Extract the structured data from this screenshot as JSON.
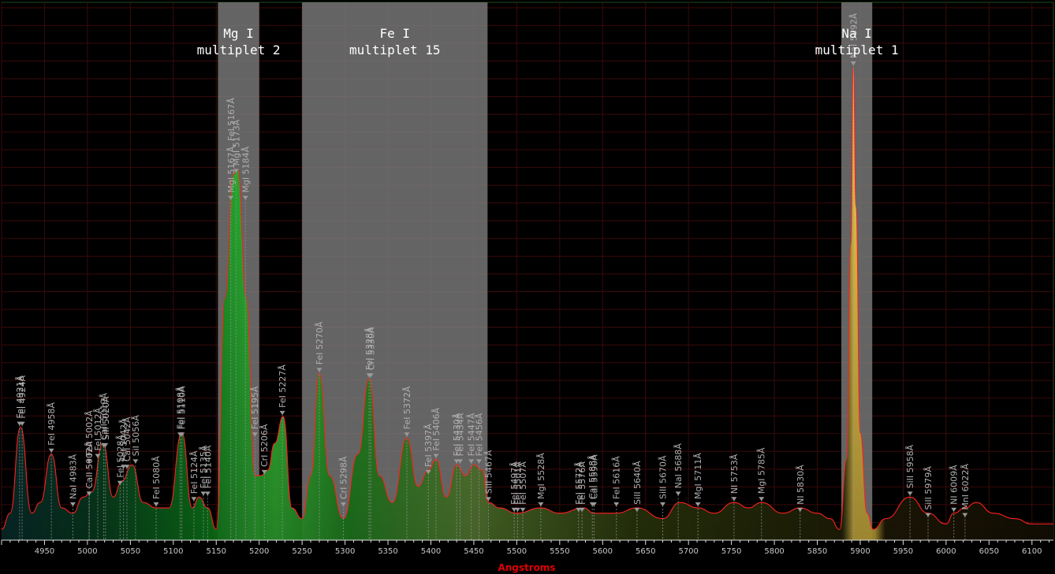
{
  "chart_data": {
    "type": "line",
    "title": "",
    "xlabel": "Angstroms",
    "ylabel": "",
    "xlim": [
      4900,
      6125
    ],
    "ylim": [
      0,
      1.0
    ],
    "grid": true,
    "x_ticks": [
      4950,
      5000,
      5050,
      5100,
      5150,
      5200,
      5250,
      5300,
      5350,
      5400,
      5450,
      5500,
      5550,
      5600,
      5650,
      5700,
      5750,
      5800,
      5850,
      5900,
      5950,
      6000,
      6050,
      6100
    ],
    "x_tick_labels": [
      "4950",
      "5000",
      "5050",
      "5100",
      "5150",
      "5200",
      "5250",
      "5300",
      "5350",
      "5400",
      "5450",
      "5500",
      "5550",
      "5600",
      "5650",
      "5700",
      "5750",
      "5800",
      "5850",
      "5900",
      "5950",
      "6000",
      "6050",
      "6100"
    ],
    "bands": [
      {
        "from": 5152,
        "to": 5200,
        "label_line1": "Mg I",
        "label_line2": "multiplet 2"
      },
      {
        "from": 5250,
        "to": 5466,
        "label_line1": "Fe I",
        "label_line2": "multiplet 15"
      },
      {
        "from": 5878,
        "to": 5914,
        "label_line1": "Na I",
        "label_line2": "multiplet 1"
      }
    ],
    "series": [
      {
        "color": "#ff2020",
        "x": [
          4900,
          4910,
          4922,
          4935,
          4945,
          4958,
          4970,
          4983,
          4995,
          5005,
          5018,
          5030,
          5040,
          5052,
          5065,
          5080,
          5095,
          5110,
          5122,
          5130,
          5140,
          5150,
          5160,
          5170,
          5175,
          5185,
          5195,
          5202,
          5210,
          5218,
          5228,
          5238,
          5250,
          5260,
          5270,
          5282,
          5298,
          5315,
          5328,
          5340,
          5355,
          5372,
          5385,
          5397,
          5406,
          5418,
          5430,
          5440,
          5450,
          5460,
          5467,
          5480,
          5500,
          5528,
          5550,
          5578,
          5590,
          5616,
          5640,
          5670,
          5690,
          5711,
          5730,
          5753,
          5770,
          5785,
          5810,
          5830,
          5850,
          5865,
          5876,
          5884,
          5889,
          5892,
          5895,
          5900,
          5908,
          5915,
          5930,
          5958,
          5979,
          6000,
          6009,
          6022,
          6035,
          6055,
          6080,
          6100,
          6125
        ],
        "y": [
          0.02,
          0.05,
          0.21,
          0.05,
          0.07,
          0.16,
          0.06,
          0.05,
          0.08,
          0.09,
          0.18,
          0.08,
          0.11,
          0.14,
          0.07,
          0.06,
          0.06,
          0.2,
          0.06,
          0.08,
          0.06,
          0.02,
          0.45,
          0.68,
          0.69,
          0.45,
          0.12,
          0.12,
          0.13,
          0.18,
          0.23,
          0.06,
          0.04,
          0.12,
          0.31,
          0.12,
          0.04,
          0.16,
          0.3,
          0.12,
          0.07,
          0.19,
          0.1,
          0.13,
          0.15,
          0.08,
          0.14,
          0.12,
          0.14,
          0.13,
          0.07,
          0.06,
          0.05,
          0.06,
          0.05,
          0.06,
          0.05,
          0.05,
          0.06,
          0.04,
          0.07,
          0.06,
          0.05,
          0.07,
          0.06,
          0.07,
          0.05,
          0.06,
          0.05,
          0.04,
          0.02,
          0.15,
          0.55,
          0.88,
          0.62,
          0.2,
          0.05,
          0.02,
          0.04,
          0.08,
          0.05,
          0.03,
          0.05,
          0.06,
          0.07,
          0.05,
          0.04,
          0.03,
          0.03
        ]
      }
    ],
    "annotations": [
      {
        "label": "FeI 4921Å",
        "x": 4921,
        "y": 0.21
      },
      {
        "label": "FeI 4924Å",
        "x": 4924,
        "y": 0.21
      },
      {
        "label": "FeI 4958Å",
        "x": 4958,
        "y": 0.16
      },
      {
        "label": "NaI 4983Å",
        "x": 4983,
        "y": 0.06
      },
      {
        "label": "CaII 5002Å",
        "x": 5002,
        "y": 0.08
      },
      {
        "label": "FeII 5002Å",
        "x": 5002,
        "y": 0.14
      },
      {
        "label": "FeI 5012Å",
        "x": 5012,
        "y": 0.15
      },
      {
        "label": "CaII 5019Å",
        "x": 5019,
        "y": 0.17
      },
      {
        "label": "SiII 5020Å",
        "x": 5021,
        "y": 0.17
      },
      {
        "label": "FeI 5028Å",
        "x": 5038,
        "y": 0.1
      },
      {
        "label": "FeI 5042Å",
        "x": 5042,
        "y": 0.13
      },
      {
        "label": "CaI 5042Å",
        "x": 5046,
        "y": 0.13
      },
      {
        "label": "SiI 5056Å",
        "x": 5056,
        "y": 0.14
      },
      {
        "label": "FeI 5080Å",
        "x": 5080,
        "y": 0.06
      },
      {
        "label": "FeI 5108Å",
        "x": 5108,
        "y": 0.19
      },
      {
        "label": "FeI 5110Å",
        "x": 5110,
        "y": 0.19
      },
      {
        "label": "FeI 5124Å",
        "x": 5124,
        "y": 0.07
      },
      {
        "label": "FeI 5135Å",
        "x": 5135,
        "y": 0.08
      },
      {
        "label": "FeI 5140Å",
        "x": 5140,
        "y": 0.08
      },
      {
        "label": "MgI 5167Å, FeI 5167Å",
        "x": 5167,
        "y": 0.63
      },
      {
        "label": "MgI 5173Å",
        "x": 5173,
        "y": 0.68
      },
      {
        "label": "MgI 5184Å",
        "x": 5184,
        "y": 0.63
      },
      {
        "label": "FeI 5195Å",
        "x": 5195,
        "y": 0.19
      },
      {
        "label": "CrI 5206Å",
        "x": 5206,
        "y": 0.12
      },
      {
        "label": "FeI 5227Å",
        "x": 5227,
        "y": 0.23
      },
      {
        "label": "FeI 5270Å",
        "x": 5270,
        "y": 0.31
      },
      {
        "label": "CrI 5298Å",
        "x": 5298,
        "y": 0.06
      },
      {
        "label": "FeI 5328Å",
        "x": 5328,
        "y": 0.3
      },
      {
        "label": "CrI 5330Å",
        "x": 5330,
        "y": 0.3
      },
      {
        "label": "FeI 5372Å",
        "x": 5372,
        "y": 0.19
      },
      {
        "label": "FeI 5397Å",
        "x": 5397,
        "y": 0.12
      },
      {
        "label": "FeI 5406Å",
        "x": 5406,
        "y": 0.15
      },
      {
        "label": "FeI 5430Å",
        "x": 5430,
        "y": 0.14
      },
      {
        "label": "FeI 5434Å",
        "x": 5434,
        "y": 0.14
      },
      {
        "label": "FeI 5447Å",
        "x": 5447,
        "y": 0.14
      },
      {
        "label": "FeI 5456Å",
        "x": 5456,
        "y": 0.14
      },
      {
        "label": "SiII 5467Å",
        "x": 5467,
        "y": 0.07
      },
      {
        "label": "FeI 5497Å",
        "x": 5497,
        "y": 0.05
      },
      {
        "label": "FeI 5501Å",
        "x": 5501,
        "y": 0.05
      },
      {
        "label": "FeI 5507Å",
        "x": 5507,
        "y": 0.05
      },
      {
        "label": "MgI 5528Å",
        "x": 5528,
        "y": 0.06
      },
      {
        "label": "FeI 5572Å",
        "x": 5572,
        "y": 0.05
      },
      {
        "label": "FeI 5576Å",
        "x": 5576,
        "y": 0.05
      },
      {
        "label": "CaI 5588Å",
        "x": 5588,
        "y": 0.06
      },
      {
        "label": "CaI 5590Å",
        "x": 5590,
        "y": 0.06
      },
      {
        "label": "FeI 5616Å",
        "x": 5616,
        "y": 0.06
      },
      {
        "label": "SiII 5640Å",
        "x": 5640,
        "y": 0.05
      },
      {
        "label": "SiII 5670Å",
        "x": 5670,
        "y": 0.06
      },
      {
        "label": "NaI 5688Å",
        "x": 5688,
        "y": 0.08
      },
      {
        "label": "MgI 5711Å",
        "x": 5711,
        "y": 0.06
      },
      {
        "label": "NI 5753Å",
        "x": 5753,
        "y": 0.07
      },
      {
        "label": "MgI 5785Å",
        "x": 5785,
        "y": 0.07
      },
      {
        "label": "NI 5830Å",
        "x": 5830,
        "y": 0.05
      },
      {
        "label": "NaI 5892Å",
        "x": 5892,
        "y": 0.88
      },
      {
        "label": "SiII 5958Å",
        "x": 5958,
        "y": 0.08
      },
      {
        "label": "SiII 5979Å",
        "x": 5979,
        "y": 0.04
      },
      {
        "label": "NI 6009Å",
        "x": 6009,
        "y": 0.05
      },
      {
        "label": "MnI 6022Å",
        "x": 6022,
        "y": 0.04
      }
    ]
  }
}
